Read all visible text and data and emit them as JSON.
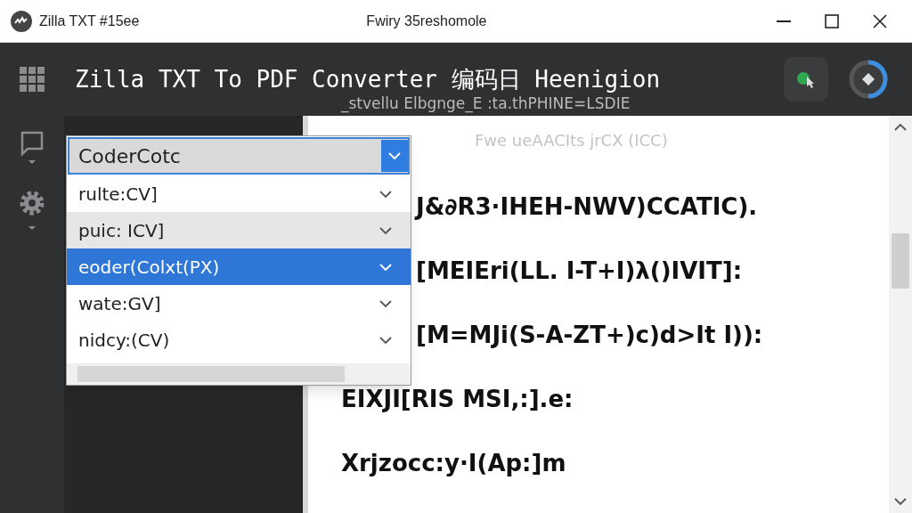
{
  "window": {
    "title": "Zilla TXT #15ee",
    "subtitle": "Fwiry 35reshomole"
  },
  "header": {
    "title": "Zilla TXT To PDF Converter 编码日 Heenigion",
    "faded_line": "_stvellu Elbgnge_E   :ta.thPHINE=LSDIE"
  },
  "dropdown": {
    "value": "CoderCotc",
    "expanded": true,
    "options": [
      {
        "label": "rulte:CV]",
        "selected": false,
        "highlighted": false
      },
      {
        "label": "puic: ICV]",
        "selected": false,
        "highlighted": true
      },
      {
        "label": "eoder(Colxt(PX)",
        "selected": true,
        "highlighted": false
      },
      {
        "label": "wate:GV]",
        "selected": false,
        "highlighted": false
      },
      {
        "label": "nidcy:(CV)",
        "selected": false,
        "highlighted": false
      }
    ]
  },
  "document": {
    "faded_line": "Fwe   ueAACIts jrCX   (ICC)",
    "lines_beside_dropdown": [
      "J&∂R3·IHEH-NWV)CCATIC).",
      "[MEIEri(LL. I-T+I)λ()IVIT]:",
      "[M=MJi(S-A-ZT+)c)d>It I)):"
    ],
    "lines": [
      "EIXJI[RIS MSI,:].e:",
      "Xrjzocc:y·I(Ap:]m"
    ]
  }
}
